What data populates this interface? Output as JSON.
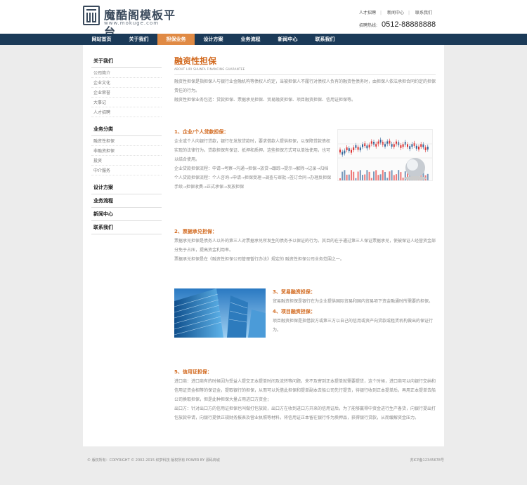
{
  "brand": {
    "title": "魔酷阁模板平台",
    "url": "www.mokuge.com"
  },
  "toplinks": [
    "人才招聘",
    "新闻中心",
    "联系我们"
  ],
  "hotline": {
    "label": "招聘热线:",
    "number": "0512-88888888"
  },
  "nav": [
    "网站首页",
    "关于我们",
    "担保业务",
    "设计方案",
    "业务流程",
    "新闻中心",
    "联系我们"
  ],
  "nav_active_index": 2,
  "sidebar": {
    "about": {
      "title": "关于我们",
      "items": [
        "公司简介",
        "企业文化",
        "企业荣誉",
        "大事记",
        "人才招聘"
      ]
    },
    "business": {
      "title": "业务分类",
      "items": [
        "融资性担保",
        "非融资担保",
        "投资",
        "中介服务"
      ]
    },
    "design": "设计方案",
    "process": "业务流程",
    "news": "新闻中心",
    "contact": "联系我们"
  },
  "page": {
    "title": "融资性担保",
    "subtitle": "ABOUT LIRI SHUNFA FINANCING GUARANTEE"
  },
  "intro": "融资性担保是指担保人与银行业金融机构等债权人约定，当被担保人不履行对债权人负有的融资性债务时，由担保人依法承担合同约定的担保责任的行为。\n融资性担保业务包括：贷款担保、票据承兑担保、贸易融资担保、项目融资担保、信用证担保等。",
  "sec1": {
    "title": "1、企业/个人贷款担保：",
    "body": "企业或个人向银行贷款，银行在发放贷款时，要求借款人提供担保，以保障贷款债权实现的法律行为。贷款担保有保证、抵押和质押。这些担保方式可以单独使用，也可以结合使用。\n企业贷款担保流程：申请→考察→沟通→担保→放贷→跟踪→提示→解除→记录→归档\n个人贷款担保流程：个人咨询→申请→担保受理→调查与审批→签订合同→办理反担保手续→担保收费→正式承保→发放担保"
  },
  "sec2": {
    "title": "2、票据承兑担保：",
    "body": "票据承兑担保是债务人以外的第三人对票据承兑所发生的债务予以保证的行为。其目的在于通过第三人保证票据承兑，使被保证人经营资金部分免于占压，提高资金利用率。\n票据承兑担保是在《融资性担保公司管理暂行办法》规定的 融资性担保公司业务范围之一。"
  },
  "sec3": {
    "title": "3、贸易融资担保：",
    "body": "贸易融资担保是银行在为企业提供国际贸易和国内贸易项下资金融通时所需要的担保。"
  },
  "sec4": {
    "title": "4、项目融资担保：",
    "body": "项目融资担保是指借款方或第三方以自己的信用或资产向贷款或租赁机构做出的保证行为。"
  },
  "sec5": {
    "title": "5、信用证担保：",
    "body": "进口商：进口商有的时候因为受益人提交正本提单时间及流转等问题，来不及寄到正本提单就需要提货，这个时候，进口商可以向银行交纳和信用证资金相等的保证金，提取银行的担保，从而可以凭借此担保和提单副本去船公司先行提货，待银行收到正本提单后，再用正本提单去船公司换取担保，但是此种担保大量占用进口方资金；\n出口方：针对出口方的信用证担保也叫做打包放款，出口方在收到进口方开来的信用证后，为了能够赢得中资金进行生产备货，向银行提出打包放款申请，向银行提供正规财务报表及营业执照等材料，将信用证正本留在银行作为质押品，获得银行贷款，从而缓解资金压力。"
  },
  "footer": {
    "left": "© 版权所有：COPYRIGHT © 2002-2015 织梦科技 版权所有 POWER BY 源码商城",
    "right": "苏ICP备12345678号"
  },
  "colors": {
    "accent": "#e08a44",
    "nav_bg": "#1b3a58",
    "title": "#d2691e"
  }
}
